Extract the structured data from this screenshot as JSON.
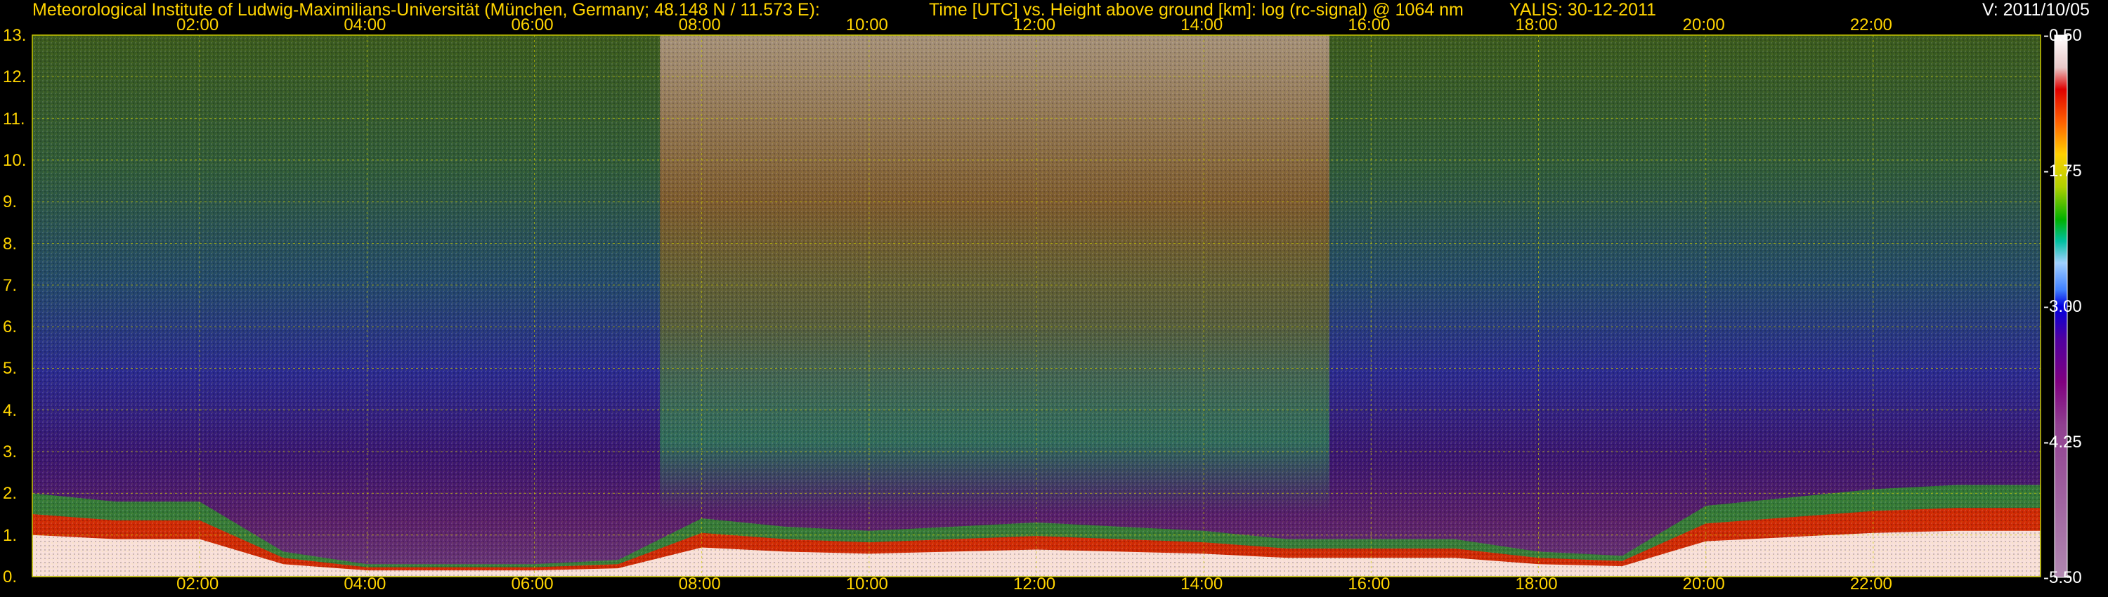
{
  "header": {
    "institute": "Meteorological Institute of Ludwig-Maximilians-Universität (München, Germany; 48.148 N / 11.573 E):",
    "title": "Time [UTC] vs. Height above ground [km]: log (rc-signal) @ 1064 nm",
    "instrument_date": "YALIS: 30-12-2011",
    "version": "V: 2011/10/05"
  },
  "colors": {
    "background": "#000000",
    "label": "#ffd400",
    "grid": "#c8c800",
    "version_text": "#ffffff"
  },
  "chart_data": {
    "type": "heatmap",
    "title": "Time [UTC] vs. Height above ground [km]: log (rc-signal) @ 1064 nm",
    "xlabel": "Time [UTC]",
    "ylabel": "Height above ground [km]",
    "xlim": [
      0,
      24
    ],
    "ylim": [
      0,
      13
    ],
    "x_ticks": [
      "02:00",
      "04:00",
      "06:00",
      "08:00",
      "10:00",
      "12:00",
      "14:00",
      "16:00",
      "18:00",
      "20:00",
      "22:00"
    ],
    "x_tick_hours": [
      2,
      4,
      6,
      8,
      10,
      12,
      14,
      16,
      18,
      20,
      22
    ],
    "y_ticks": [
      "13.",
      "12.",
      "11.",
      "10.",
      "9.",
      "8.",
      "7.",
      "6.",
      "5.",
      "4.",
      "3.",
      "2.",
      "1.",
      "0."
    ],
    "y_tick_values": [
      13,
      12,
      11,
      10,
      9,
      8,
      7,
      6,
      5,
      4,
      3,
      2,
      1,
      0
    ],
    "grid": true,
    "colorbar": {
      "ticks": [
        "-0.50",
        "-1.75",
        "-3.00",
        "-4.25",
        "-5.50"
      ],
      "values": [
        -0.5,
        -1.75,
        -3.0,
        -4.25,
        -5.5
      ],
      "range": [
        -5.5,
        -0.5
      ]
    },
    "boundary_layer_top_km": {
      "hours": [
        0,
        1,
        2,
        3,
        4,
        5,
        6,
        7,
        8,
        9,
        10,
        11,
        12,
        13,
        14,
        15,
        16,
        17,
        18,
        19,
        20,
        21,
        22,
        23,
        24
      ],
      "values": [
        2.0,
        1.8,
        1.8,
        0.6,
        0.3,
        0.3,
        0.3,
        0.4,
        1.4,
        1.2,
        1.1,
        1.2,
        1.3,
        1.2,
        1.1,
        0.9,
        0.9,
        0.9,
        0.6,
        0.5,
        1.7,
        1.9,
        2.1,
        2.2,
        2.2
      ]
    }
  }
}
